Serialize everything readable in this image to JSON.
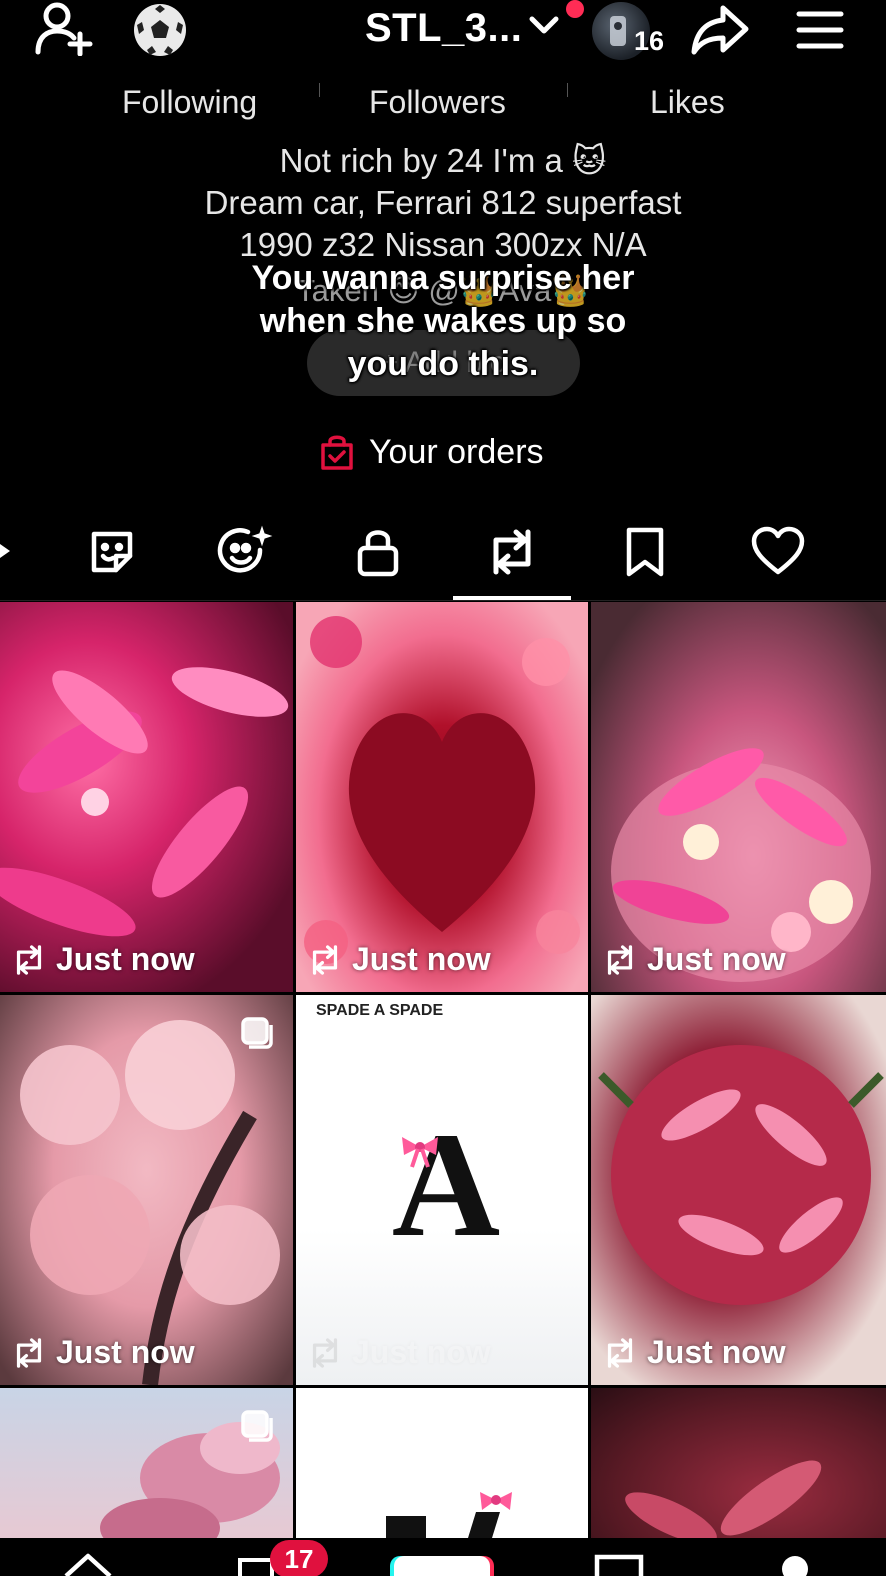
{
  "header": {
    "username": "STL_3...",
    "avatar_badge_count": "16",
    "icons": [
      "add-friend-icon",
      "soccer-ball-icon",
      "chevron-down-icon",
      "share-icon",
      "menu-icon"
    ]
  },
  "stats": [
    {
      "label": "Following"
    },
    {
      "label": "Followers"
    },
    {
      "label": "Likes"
    }
  ],
  "bio": {
    "line1": "Not rich by 24 I'm a 🐱",
    "line2": "Dream car, Ferrari 812 superfast",
    "line3": "1990 z32 Nissan 300zx N/A",
    "line4_partial": "Taken 😊 @👑Ava👑",
    "add_button_partial": "+ Add bio"
  },
  "video_caption": {
    "line1": "You wanna surprise her",
    "line2": "when she wakes up so",
    "line3": "you do this."
  },
  "orders": {
    "label": "Your orders"
  },
  "tabs": [
    {
      "name": "stickers",
      "icon": "sticker-icon"
    },
    {
      "name": "ai-self",
      "icon": "sparkle-face-icon"
    },
    {
      "name": "private",
      "icon": "lock-icon"
    },
    {
      "name": "reposts",
      "icon": "repost-icon",
      "active": true
    },
    {
      "name": "favorites",
      "icon": "bookmark-icon"
    },
    {
      "name": "liked",
      "icon": "heart-icon"
    }
  ],
  "grid": [
    {
      "stamp": "Just now",
      "theme": "pink lilies"
    },
    {
      "stamp": "Just now",
      "theme": "rose heart bouquet"
    },
    {
      "stamp": "Just now",
      "theme": "lily and rose bouquet"
    },
    {
      "stamp": "Just now",
      "theme": "cherry blossoms",
      "multi": true
    },
    {
      "stamp": "Just now",
      "theme": "letter A with bow",
      "brand": "SPADE A SPADE",
      "letter": "A"
    },
    {
      "stamp": "Just now",
      "theme": "lily bouquet"
    },
    {
      "stamp": "",
      "theme": "magnolia",
      "multi": true
    },
    {
      "stamp": "",
      "theme": "letter with bow"
    },
    {
      "stamp": "",
      "theme": "dark lilies"
    }
  ],
  "bottom_nav": {
    "inbox_badge": "17"
  },
  "colors": {
    "background": "#000000",
    "accent_red": "#ff2c55",
    "badge_red": "#e0113e",
    "text": "#ffffff"
  }
}
